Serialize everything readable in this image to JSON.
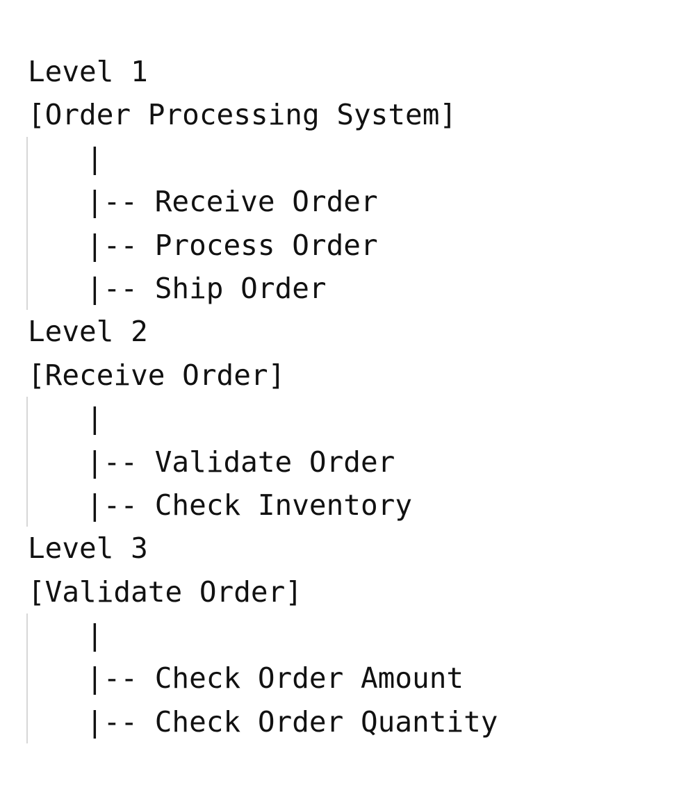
{
  "levels": [
    {
      "heading": "Level 1",
      "node": "[Order Processing System]",
      "connector": "|",
      "branch_prefix": "|-- ",
      "children": [
        "Receive Order",
        "Process Order",
        "Ship Order"
      ]
    },
    {
      "heading": "Level 2",
      "node": "[Receive Order]",
      "connector": "|",
      "branch_prefix": "|-- ",
      "children": [
        "Validate Order",
        "Check Inventory"
      ]
    },
    {
      "heading": "Level 3",
      "node": "[Validate Order]",
      "connector": "|",
      "branch_prefix": "|-- ",
      "children": [
        "Check Order Amount",
        "Check Order Quantity"
      ]
    }
  ]
}
